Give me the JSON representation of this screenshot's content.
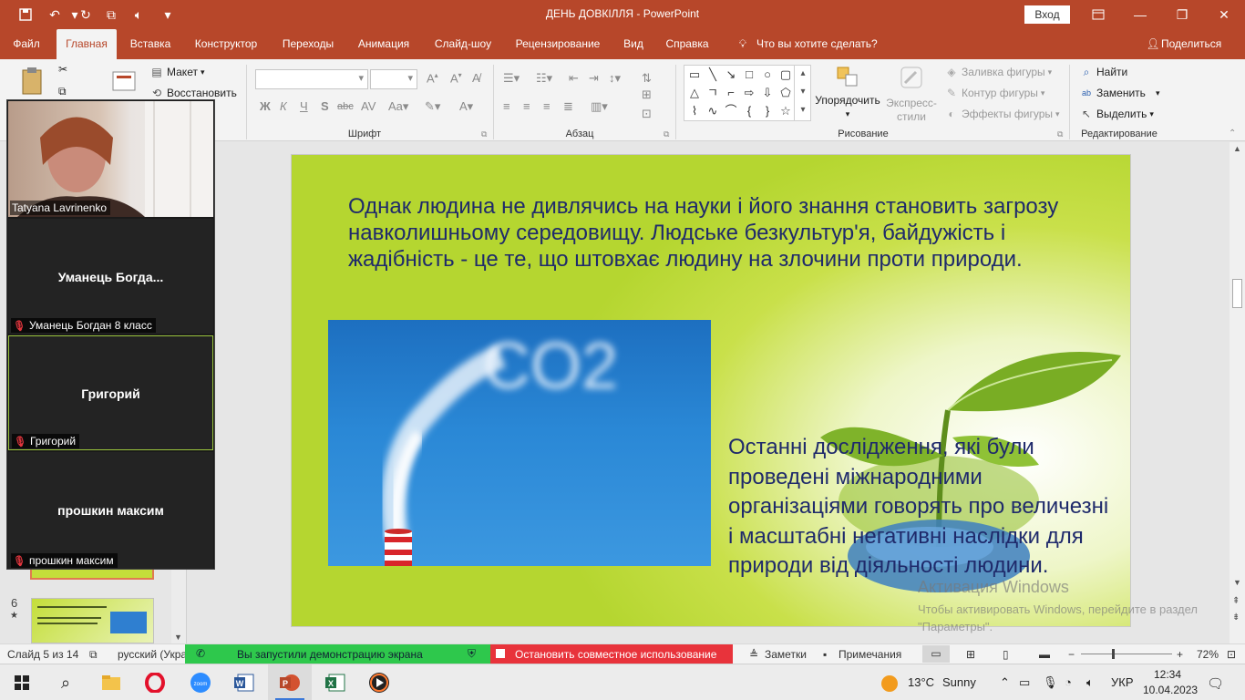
{
  "window": {
    "title": "ДЕНЬ ДОВКІЛЛЯ  -  PowerPoint",
    "login_label": "Вход"
  },
  "ribbon": {
    "tabs": [
      "Файл",
      "Главная",
      "Вставка",
      "Конструктор",
      "Переходы",
      "Анимация",
      "Слайд-шоу",
      "Рецензирование",
      "Вид",
      "Справка"
    ],
    "active_tab": "Главная",
    "tell_me": "Что вы хотите сделать?",
    "share": "Поделиться",
    "slides_group": {
      "layout": "Макет",
      "reset": "Восстановить"
    },
    "group_labels": {
      "font": "Шрифт",
      "paragraph": "Абзац",
      "drawing": "Рисование",
      "editing": "Редактирование"
    },
    "drawing": {
      "arrange": "Упорядочить",
      "quick_styles": "Экспресс-стили",
      "fill": "Заливка фигуры",
      "outline": "Контур фигуры",
      "effects": "Эффекты фигуры"
    },
    "editing": {
      "find": "Найти",
      "replace": "Заменить",
      "select": "Выделить"
    },
    "font_format": {
      "bold": "Ж",
      "italic": "К",
      "underline": "Ч",
      "strike": "S",
      "spacing": "abc"
    }
  },
  "slide": {
    "top_text": "Однак людина не дивлячись на науки і його знання становить загрозу навколишньому середовищу. Людське безкультур'я, байдужість і жадібність - це те, що штовхає людину на злочини проти природи.",
    "side_text": "Останні дослідження, які були проведені міжнародними організаціями говорять про величезні і масштабні негативні наслідки для природи від діяльності людини.",
    "image_smoke_text": "CO2"
  },
  "activation": {
    "line1": "Активация Windows",
    "line2": "Чтобы активировать Windows, перейдите в раздел \"Параметры\"."
  },
  "thumbnails": {
    "visible_number": "6",
    "star": "★"
  },
  "zoom": {
    "participants": [
      {
        "name": "Tatyana Lavrinenko",
        "video": true
      },
      {
        "name": "Уманець  Богда...",
        "tag": "Уманець Богдан 8 класс",
        "muted": true
      },
      {
        "name": "Григорий",
        "tag": "Григорий",
        "muted": true,
        "speaking": true
      },
      {
        "name": "прошкин максим",
        "tag": "прошкин максим",
        "muted": true
      }
    ]
  },
  "statusbar": {
    "slide_info": "Слайд 5 из 14",
    "language": "русский (Укра",
    "sharing_notice": "Вы запустили демонстрацию экрана",
    "stop_sharing": "Остановить совместное использование",
    "notes": "Заметки",
    "comments": "Примечания",
    "zoom_level": "72%"
  },
  "taskbar": {
    "weather_temp": "13°C",
    "weather_text": "Sunny",
    "language": "УКР",
    "time": "12:34",
    "date": "10.04.2023"
  },
  "colors": {
    "accent": "#b7472a",
    "slide_text": "#1f2a6b",
    "slide_green": "#b5d630",
    "share_green": "#2ec84c",
    "share_red": "#e8333b"
  }
}
